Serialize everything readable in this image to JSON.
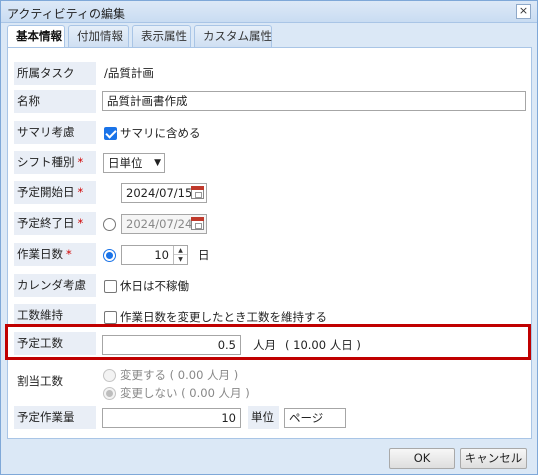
{
  "window": {
    "title": "アクティビティの編集",
    "close": "×"
  },
  "tabs": [
    {
      "label": "基本情報",
      "active": true
    },
    {
      "label": "付加情報",
      "active": false
    },
    {
      "label": "表示属性",
      "active": false
    },
    {
      "label": "カスタム属性",
      "active": false
    }
  ],
  "required_mark": "*",
  "form": {
    "parent_task": {
      "label": "所属タスク",
      "value": "/品質計画"
    },
    "name": {
      "label": "名称",
      "value": "品質計画書作成"
    },
    "summary": {
      "label": "サマリ考慮",
      "checkbox_label": "サマリに含める",
      "checked": true
    },
    "shift": {
      "label": "シフト種別",
      "value": "日単位"
    },
    "start_date": {
      "label": "予定開始日",
      "value": "2024/07/15"
    },
    "end_date": {
      "label": "予定終了日",
      "value": "2024/07/24"
    },
    "work_days": {
      "label": "作業日数",
      "value": "10",
      "unit": "日"
    },
    "calendar": {
      "label": "カレンダ考慮",
      "checkbox_label": "休日は不稼働",
      "checked": false
    },
    "keep_effort": {
      "label": "工数維持",
      "checkbox_label": "作業日数を変更したとき工数を維持する",
      "checked": false
    },
    "planned_effort": {
      "label": "予定工数",
      "value": "0.5",
      "unit": "人月",
      "note": "( 10.00 人日 )"
    },
    "allocated_effort": {
      "label": "割当工数",
      "option_change": "変更する ( 0.00 人月 )",
      "option_nochange": "変更しない ( 0.00 人月 )"
    },
    "planned_volume": {
      "label": "予定作業量",
      "value": "10",
      "unit_label": "単位",
      "unit_value": "ページ"
    }
  },
  "buttons": {
    "ok": "OK",
    "cancel": "キャンセル"
  },
  "colors": {
    "accent": "#1a73e8",
    "highlight": "#c00000",
    "required": "#d00000"
  }
}
